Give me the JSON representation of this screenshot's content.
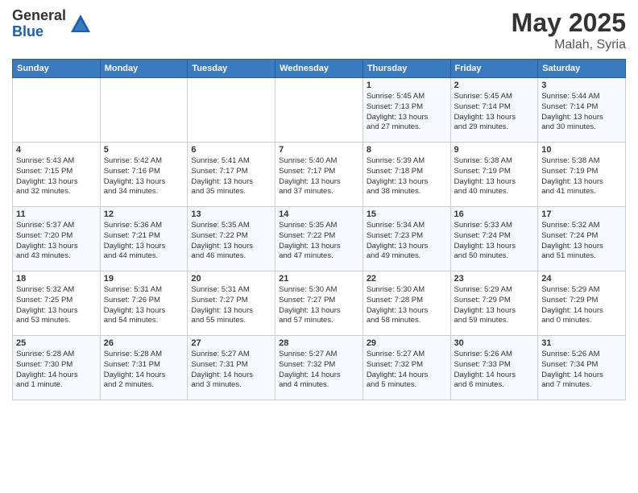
{
  "header": {
    "logo_general": "General",
    "logo_blue": "Blue",
    "month_year": "May 2025",
    "location": "Malah, Syria"
  },
  "weekdays": [
    "Sunday",
    "Monday",
    "Tuesday",
    "Wednesday",
    "Thursday",
    "Friday",
    "Saturday"
  ],
  "weeks": [
    [
      {
        "day": "",
        "detail": ""
      },
      {
        "day": "",
        "detail": ""
      },
      {
        "day": "",
        "detail": ""
      },
      {
        "day": "",
        "detail": ""
      },
      {
        "day": "1",
        "detail": "Sunrise: 5:45 AM\nSunset: 7:13 PM\nDaylight: 13 hours\nand 27 minutes."
      },
      {
        "day": "2",
        "detail": "Sunrise: 5:45 AM\nSunset: 7:14 PM\nDaylight: 13 hours\nand 29 minutes."
      },
      {
        "day": "3",
        "detail": "Sunrise: 5:44 AM\nSunset: 7:14 PM\nDaylight: 13 hours\nand 30 minutes."
      }
    ],
    [
      {
        "day": "4",
        "detail": "Sunrise: 5:43 AM\nSunset: 7:15 PM\nDaylight: 13 hours\nand 32 minutes."
      },
      {
        "day": "5",
        "detail": "Sunrise: 5:42 AM\nSunset: 7:16 PM\nDaylight: 13 hours\nand 34 minutes."
      },
      {
        "day": "6",
        "detail": "Sunrise: 5:41 AM\nSunset: 7:17 PM\nDaylight: 13 hours\nand 35 minutes."
      },
      {
        "day": "7",
        "detail": "Sunrise: 5:40 AM\nSunset: 7:17 PM\nDaylight: 13 hours\nand 37 minutes."
      },
      {
        "day": "8",
        "detail": "Sunrise: 5:39 AM\nSunset: 7:18 PM\nDaylight: 13 hours\nand 38 minutes."
      },
      {
        "day": "9",
        "detail": "Sunrise: 5:38 AM\nSunset: 7:19 PM\nDaylight: 13 hours\nand 40 minutes."
      },
      {
        "day": "10",
        "detail": "Sunrise: 5:38 AM\nSunset: 7:19 PM\nDaylight: 13 hours\nand 41 minutes."
      }
    ],
    [
      {
        "day": "11",
        "detail": "Sunrise: 5:37 AM\nSunset: 7:20 PM\nDaylight: 13 hours\nand 43 minutes."
      },
      {
        "day": "12",
        "detail": "Sunrise: 5:36 AM\nSunset: 7:21 PM\nDaylight: 13 hours\nand 44 minutes."
      },
      {
        "day": "13",
        "detail": "Sunrise: 5:35 AM\nSunset: 7:22 PM\nDaylight: 13 hours\nand 46 minutes."
      },
      {
        "day": "14",
        "detail": "Sunrise: 5:35 AM\nSunset: 7:22 PM\nDaylight: 13 hours\nand 47 minutes."
      },
      {
        "day": "15",
        "detail": "Sunrise: 5:34 AM\nSunset: 7:23 PM\nDaylight: 13 hours\nand 49 minutes."
      },
      {
        "day": "16",
        "detail": "Sunrise: 5:33 AM\nSunset: 7:24 PM\nDaylight: 13 hours\nand 50 minutes."
      },
      {
        "day": "17",
        "detail": "Sunrise: 5:32 AM\nSunset: 7:24 PM\nDaylight: 13 hours\nand 51 minutes."
      }
    ],
    [
      {
        "day": "18",
        "detail": "Sunrise: 5:32 AM\nSunset: 7:25 PM\nDaylight: 13 hours\nand 53 minutes."
      },
      {
        "day": "19",
        "detail": "Sunrise: 5:31 AM\nSunset: 7:26 PM\nDaylight: 13 hours\nand 54 minutes."
      },
      {
        "day": "20",
        "detail": "Sunrise: 5:31 AM\nSunset: 7:27 PM\nDaylight: 13 hours\nand 55 minutes."
      },
      {
        "day": "21",
        "detail": "Sunrise: 5:30 AM\nSunset: 7:27 PM\nDaylight: 13 hours\nand 57 minutes."
      },
      {
        "day": "22",
        "detail": "Sunrise: 5:30 AM\nSunset: 7:28 PM\nDaylight: 13 hours\nand 58 minutes."
      },
      {
        "day": "23",
        "detail": "Sunrise: 5:29 AM\nSunset: 7:29 PM\nDaylight: 13 hours\nand 59 minutes."
      },
      {
        "day": "24",
        "detail": "Sunrise: 5:29 AM\nSunset: 7:29 PM\nDaylight: 14 hours\nand 0 minutes."
      }
    ],
    [
      {
        "day": "25",
        "detail": "Sunrise: 5:28 AM\nSunset: 7:30 PM\nDaylight: 14 hours\nand 1 minute."
      },
      {
        "day": "26",
        "detail": "Sunrise: 5:28 AM\nSunset: 7:31 PM\nDaylight: 14 hours\nand 2 minutes."
      },
      {
        "day": "27",
        "detail": "Sunrise: 5:27 AM\nSunset: 7:31 PM\nDaylight: 14 hours\nand 3 minutes."
      },
      {
        "day": "28",
        "detail": "Sunrise: 5:27 AM\nSunset: 7:32 PM\nDaylight: 14 hours\nand 4 minutes."
      },
      {
        "day": "29",
        "detail": "Sunrise: 5:27 AM\nSunset: 7:32 PM\nDaylight: 14 hours\nand 5 minutes."
      },
      {
        "day": "30",
        "detail": "Sunrise: 5:26 AM\nSunset: 7:33 PM\nDaylight: 14 hours\nand 6 minutes."
      },
      {
        "day": "31",
        "detail": "Sunrise: 5:26 AM\nSunset: 7:34 PM\nDaylight: 14 hours\nand 7 minutes."
      }
    ]
  ]
}
